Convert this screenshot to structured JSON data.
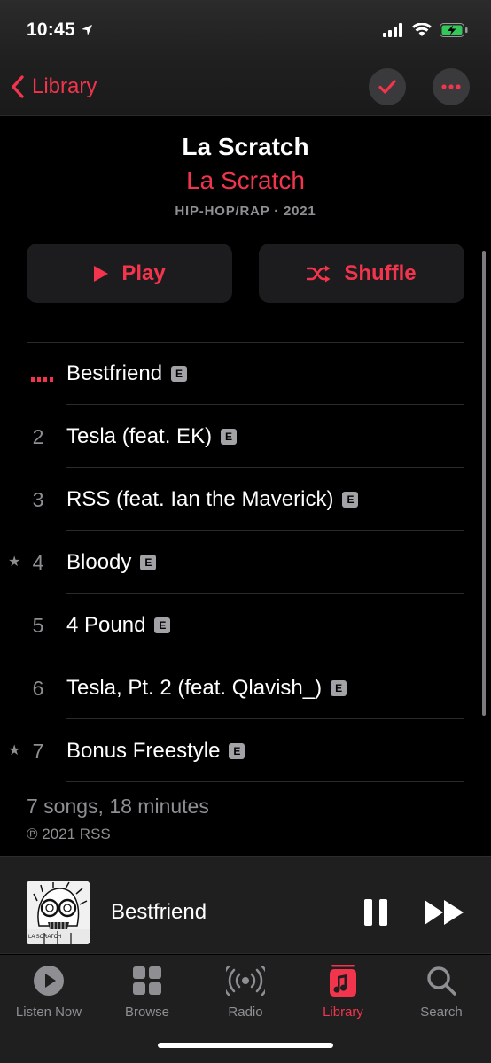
{
  "status": {
    "time": "10:45"
  },
  "nav": {
    "back_label": "Library"
  },
  "album": {
    "title": "La Scratch",
    "artist": "La Scratch",
    "meta": "HIP-HOP/RAP · 2021"
  },
  "actions": {
    "play_label": "Play",
    "shuffle_label": "Shuffle"
  },
  "tracks": [
    {
      "number": "",
      "title": "Bestfriend",
      "explicit": "E",
      "starred": false,
      "playing": true
    },
    {
      "number": "2",
      "title": "Tesla (feat. EK)",
      "explicit": "E",
      "starred": false,
      "playing": false
    },
    {
      "number": "3",
      "title": "RSS (feat. Ian the Maverick)",
      "explicit": "E",
      "starred": false,
      "playing": false
    },
    {
      "number": "4",
      "title": "Bloody",
      "explicit": "E",
      "starred": true,
      "playing": false
    },
    {
      "number": "5",
      "title": "4 Pound",
      "explicit": "E",
      "starred": false,
      "playing": false
    },
    {
      "number": "6",
      "title": "Tesla, Pt. 2 (feat. Qlavish_)",
      "explicit": "E",
      "starred": false,
      "playing": false
    },
    {
      "number": "7",
      "title": "Bonus Freestyle",
      "explicit": "E",
      "starred": true,
      "playing": false
    }
  ],
  "summary": {
    "count": "7 songs, 18 minutes",
    "copyright": "℗ 2021 RSS"
  },
  "player": {
    "now_playing": "Bestfriend",
    "artwork_text": "LA SCRATCH"
  },
  "tabs": [
    {
      "label": "Listen Now",
      "icon": "play-circle-icon"
    },
    {
      "label": "Browse",
      "icon": "grid-icon"
    },
    {
      "label": "Radio",
      "icon": "radio-icon"
    },
    {
      "label": "Library",
      "icon": "music-library-icon"
    },
    {
      "label": "Search",
      "icon": "search-icon"
    }
  ],
  "colors": {
    "accent": "#f2354d",
    "secondary_text": "#8e8e93",
    "background": "#000000"
  }
}
